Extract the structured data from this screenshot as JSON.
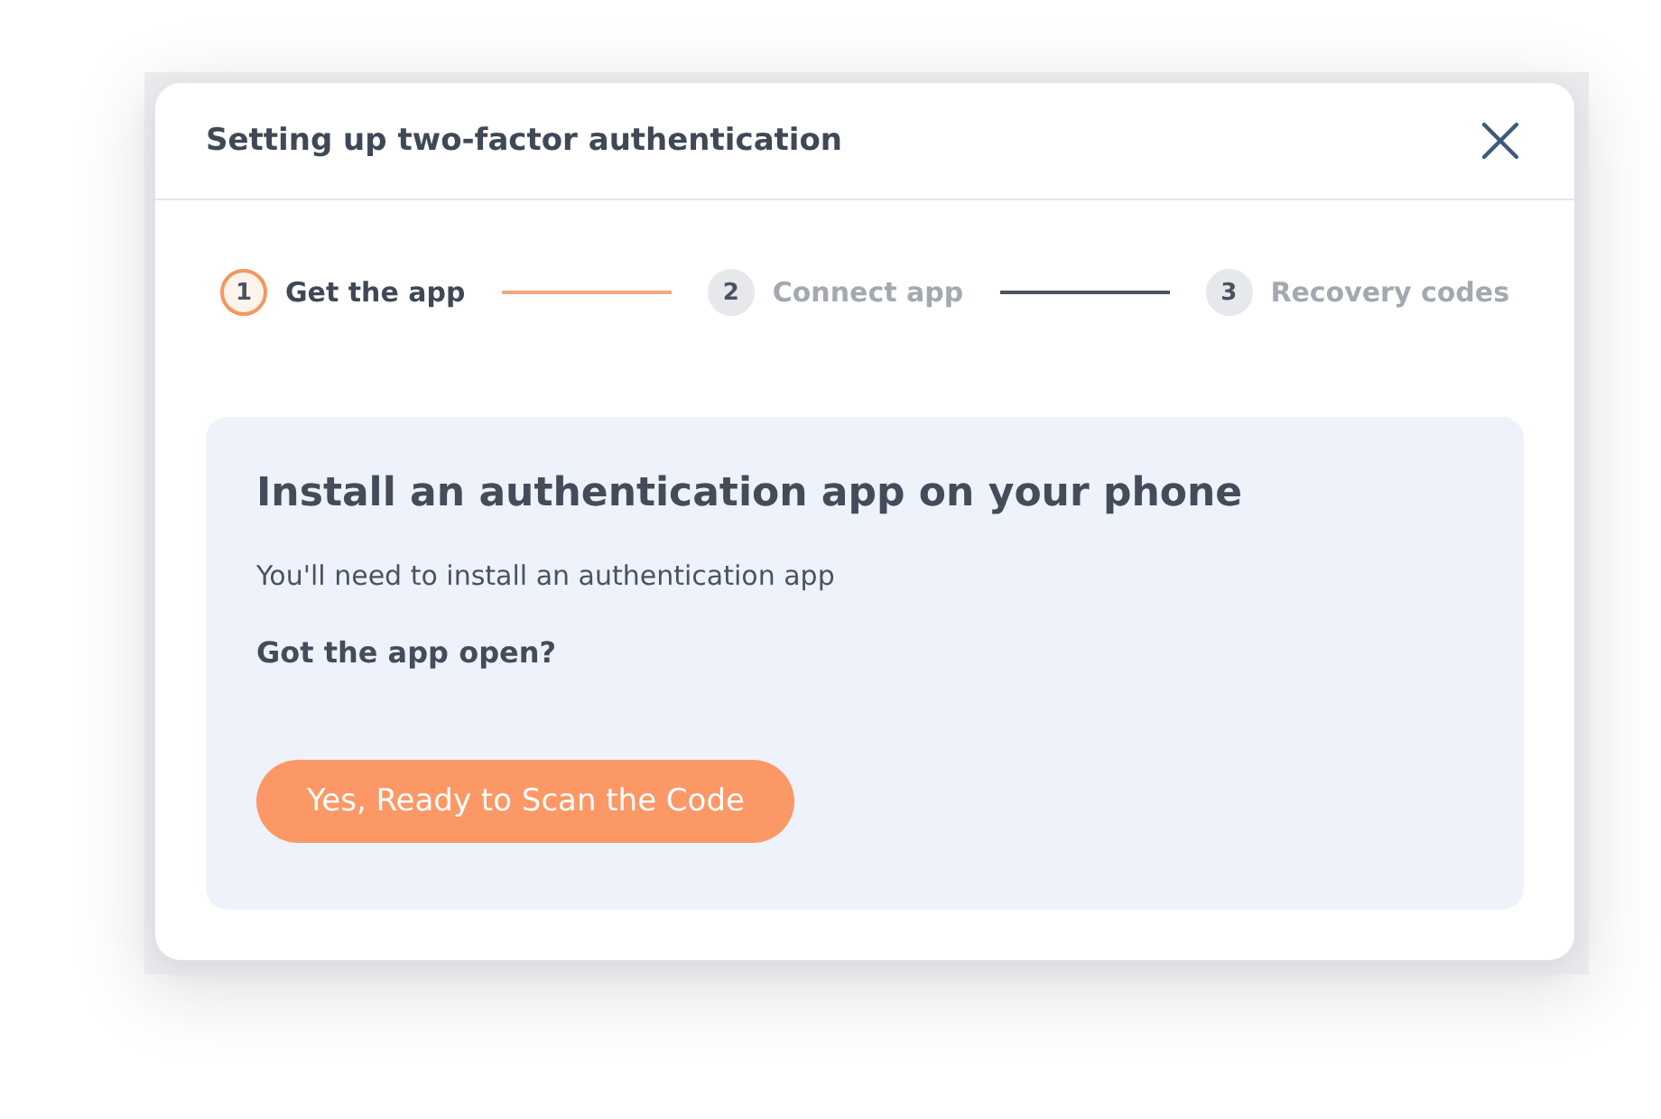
{
  "dialog": {
    "title": "Setting up two-factor authentication"
  },
  "steps": [
    {
      "number": "1",
      "label": "Get the app",
      "selected": true
    },
    {
      "number": "2",
      "label": "Connect app",
      "selected": false
    },
    {
      "number": "3",
      "label": "Recovery codes",
      "selected": false
    }
  ],
  "panel": {
    "heading": "Install an authentication app on your phone",
    "description": "You'll need to install an authentication app",
    "question": "Got the app open?",
    "button": "Yes, Ready to Scan the Code"
  }
}
